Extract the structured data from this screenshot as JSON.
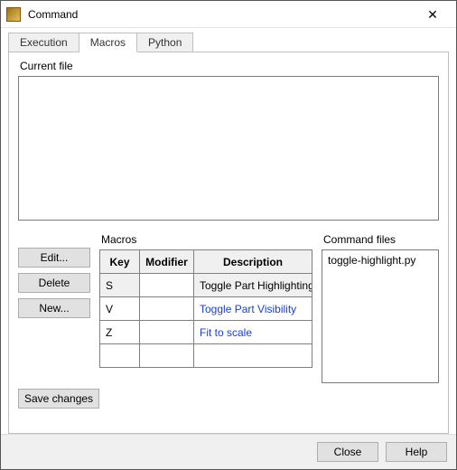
{
  "window": {
    "title": "Command",
    "icon_name": "app-icon"
  },
  "tabs": [
    {
      "label": "Execution",
      "active": false
    },
    {
      "label": "Macros",
      "active": true
    },
    {
      "label": "Python",
      "active": false
    }
  ],
  "panel": {
    "current_file_label": "Current file",
    "current_file_value": "",
    "buttons": {
      "edit": "Edit...",
      "delete": "Delete",
      "new": "New...",
      "save": "Save changes"
    },
    "macros_section_label": "Macros",
    "macros_table": {
      "headers": {
        "key": "Key",
        "modifier": "Modifier",
        "description": "Description"
      },
      "rows": [
        {
          "key": "S",
          "modifier": "",
          "description": "Toggle Part Highlighting",
          "selected": true,
          "link": false
        },
        {
          "key": "V",
          "modifier": "",
          "description": "Toggle Part Visibility",
          "selected": false,
          "link": true
        },
        {
          "key": "Z",
          "modifier": "",
          "description": "Fit to scale",
          "selected": false,
          "link": true
        },
        {
          "key": "",
          "modifier": "",
          "description": "",
          "selected": false,
          "link": false
        }
      ]
    },
    "command_files_label": "Command files",
    "command_files": [
      "toggle-highlight.py"
    ]
  },
  "footer": {
    "close": "Close",
    "help": "Help"
  }
}
